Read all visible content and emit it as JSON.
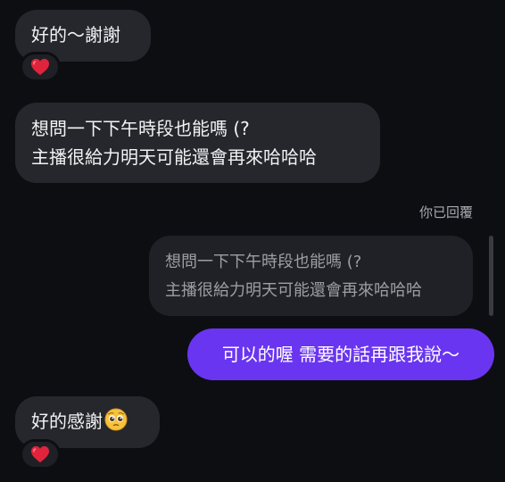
{
  "messages": {
    "m1": {
      "text": "好的～謝謝",
      "reaction_icon": "heart-icon"
    },
    "m2": {
      "line1": "想問一下下午時段也能嗎 (?",
      "line2": "主播很給力明天可能還會再來哈哈哈"
    },
    "reply_label": "你已回覆",
    "quoted": {
      "line1": "想問一下下午時段也能嗎 (?",
      "line2": "主播很給力明天可能還會再來哈哈哈"
    },
    "outgoing": {
      "text": "可以的喔 需要的話再跟我說～"
    },
    "m5": {
      "text": "好的感謝",
      "emoji": "pleading-face-emoji",
      "reaction_icon": "heart-icon"
    }
  },
  "colors": {
    "background": "#0d0e12",
    "incoming_bubble": "#26272c",
    "outgoing_bubble": "#6a35f0",
    "heart": "#e0243c"
  }
}
